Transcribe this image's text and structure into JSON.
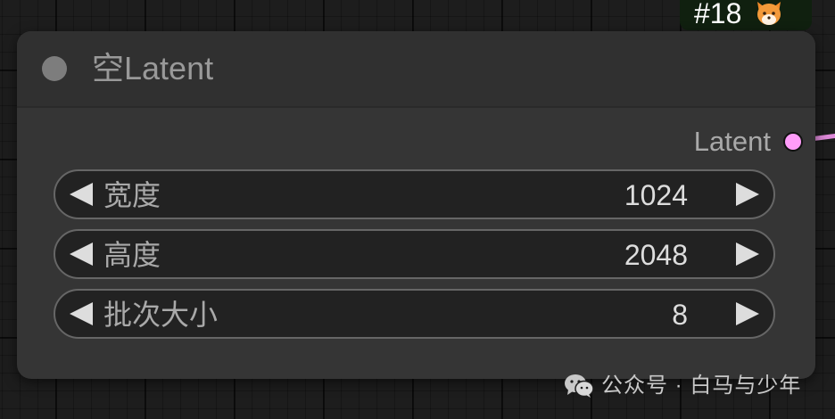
{
  "badge": {
    "label": "#18",
    "icon": "fox-icon"
  },
  "node": {
    "title": "空Latent",
    "output": {
      "label": "Latent",
      "color": "#ff9cf9"
    },
    "widgets": [
      {
        "label": "宽度",
        "value": "1024"
      },
      {
        "label": "高度",
        "value": "2048"
      },
      {
        "label": "批次大小",
        "value": "8"
      }
    ]
  },
  "watermark": {
    "icon": "wechat-icon",
    "text": "公众号 · 白马与少年"
  }
}
